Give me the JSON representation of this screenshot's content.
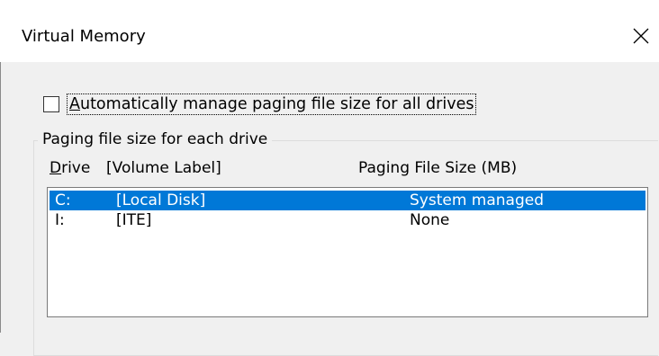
{
  "window": {
    "title": "Virtual Memory"
  },
  "auto_manage": {
    "checked": false,
    "label_prefix": "A",
    "label_rest": "utomatically manage paging file size for all drives"
  },
  "group": {
    "title": "Paging file size for each drive",
    "col_drive_hotkey": "D",
    "col_drive_rest": "rive",
    "col_volume": "[Volume Label]",
    "col_size": "Paging File Size (MB)"
  },
  "drives": [
    {
      "drive": "C:",
      "label": "[Local Disk]",
      "size": "System managed",
      "selected": true
    },
    {
      "drive": "I:",
      "label": "[ITE]",
      "size": "None",
      "selected": false
    }
  ],
  "icons": {
    "close": "close-icon"
  },
  "colors": {
    "selection": "#0078d7",
    "background": "#f0f0f0"
  }
}
